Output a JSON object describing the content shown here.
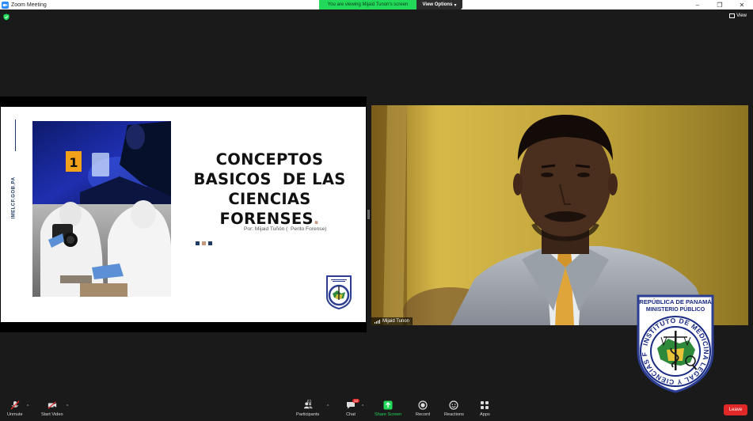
{
  "titlebar": {
    "title": "Zoom Meeting",
    "minimize": "–",
    "restore": "❐",
    "close": "✕"
  },
  "share_bar": {
    "viewing_text": "You are viewing Mijaid Tunon's screen",
    "view_options_label": "View Options",
    "view_options_chevron": "▾"
  },
  "view": {
    "label": "View"
  },
  "slide": {
    "side_text": "IMELCF.GOB.PA",
    "title_lines": [
      "CONCEPTOS",
      "BASICOS  DE LAS",
      "CIENCIAS",
      "FORENSES"
    ],
    "title_dot": ".",
    "byline": "Por: Mijaid Tuñón (  Perito Forense)",
    "dot_colors": [
      "#1f3b66",
      "#c79a7e",
      "#1f3b66"
    ]
  },
  "video": {
    "participant_name": "Mijaid Tunon"
  },
  "emblem": {
    "top_text_1": "REPÚBLICA DE PANAMÁ",
    "top_text_2": "MINISTERIO PÚBLICO",
    "ring_text": "INSTITUTO DE MEDICINA LEGAL Y CIENCIAS FORENSES"
  },
  "toolbar": {
    "unmute": "Unmute",
    "start_video": "Start Video",
    "participants": "Participants",
    "participants_count": "61",
    "chat": "Chat",
    "chat_badge": "12",
    "share_screen": "Share Screen",
    "record": "Record",
    "reactions": "Reactions",
    "apps": "Apps",
    "leave": "Leave",
    "caret": "^"
  },
  "colors": {
    "share_green": "#23d959",
    "leave_red": "#e02828",
    "slide_navy": "#1f3b66",
    "slide_accent": "#c79a7e"
  }
}
